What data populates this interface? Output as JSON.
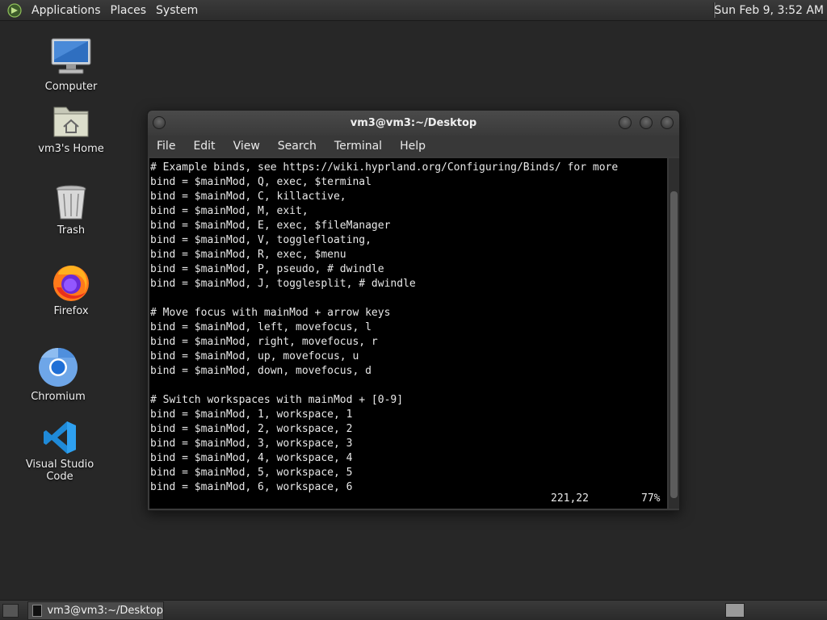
{
  "top_panel": {
    "menus": [
      "Applications",
      "Places",
      "System"
    ],
    "clock": "Sun Feb  9,  3:52 AM"
  },
  "desktop": {
    "icons": [
      {
        "label": "Computer",
        "icon": "computer-icon"
      },
      {
        "label": "vm3's Home",
        "icon": "home-folder-icon"
      },
      {
        "label": "Trash",
        "icon": "trash-icon"
      },
      {
        "label": "Firefox",
        "icon": "firefox-icon"
      },
      {
        "label": "Chromium",
        "icon": "chromium-icon"
      },
      {
        "label": "Visual Studio Code",
        "icon": "vscode-icon"
      }
    ]
  },
  "terminal": {
    "title": "vm3@vm3:~/Desktop",
    "menus": [
      "File",
      "Edit",
      "View",
      "Search",
      "Terminal",
      "Help"
    ],
    "lines": [
      "# Example binds, see https://wiki.hyprland.org/Configuring/Binds/ for more",
      "bind = $mainMod, Q, exec, $terminal",
      "bind = $mainMod, C, killactive,",
      "bind = $mainMod, M, exit,",
      "bind = $mainMod, E, exec, $fileManager",
      "bind = $mainMod, V, togglefloating,",
      "bind = $mainMod, R, exec, $menu",
      "bind = $mainMod, P, pseudo, # dwindle",
      "bind = $mainMod, J, togglesplit, # dwindle",
      "",
      "# Move focus with mainMod + arrow keys",
      "bind = $mainMod, left, movefocus, l",
      "bind = $mainMod, right, movefocus, r",
      "bind = $mainMod, up, movefocus, u",
      "bind = $mainMod, down, movefocus, d",
      "",
      "# Switch workspaces with mainMod + [0-9]",
      "bind = $mainMod, 1, workspace, 1",
      "bind = $mainMod, 2, workspace, 2",
      "bind = $mainMod, 3, workspace, 3",
      "bind = $mainMod, 4, workspace, 4",
      "bind = $mainMod, 5, workspace, 5",
      "bind = $mainMod, 6, workspace, 6"
    ],
    "cursor_position": "221,22",
    "scroll_percent": "77%",
    "scroll_fraction": 0.77
  },
  "taskbar": {
    "tasks": [
      {
        "label": "vm3@vm3:~/Desktop"
      }
    ]
  }
}
